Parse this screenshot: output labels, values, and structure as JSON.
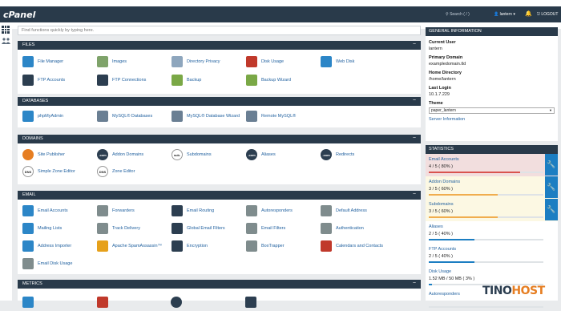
{
  "topbar": {
    "logo": "cPanel",
    "search_placeholder": "Search ( / )",
    "user": "lantern",
    "logout": "LOGOUT"
  },
  "search": {
    "placeholder": "Find functions quickly by typing here."
  },
  "files": {
    "title": "FILES",
    "toggle": "−",
    "items": [
      {
        "label": "File Manager",
        "icon": "file-manager-icon",
        "color": "#2c86c7"
      },
      {
        "label": "Images",
        "icon": "images-icon",
        "color": "#7fa36a"
      },
      {
        "label": "Directory Privacy",
        "icon": "directory-privacy-icon",
        "color": "#8ea6bd"
      },
      {
        "label": "Disk Usage",
        "icon": "disk-usage-icon",
        "color": "#c0392b"
      },
      {
        "label": "Web Disk",
        "icon": "web-disk-icon",
        "color": "#2c86c7"
      },
      {
        "label": "FTP Accounts",
        "icon": "ftp-accounts-icon",
        "color": "#2c3e50"
      },
      {
        "label": "FTP Connections",
        "icon": "ftp-connections-icon",
        "color": "#2c3e50"
      },
      {
        "label": "Backup",
        "icon": "backup-icon",
        "color": "#7aa846"
      },
      {
        "label": "Backup Wizard",
        "icon": "backup-wizard-icon",
        "color": "#7aa846"
      }
    ]
  },
  "databases": {
    "title": "DATABASES",
    "toggle": "−",
    "items": [
      {
        "label": "phpMyAdmin",
        "icon": "phpmyadmin-icon",
        "color": "#2c86c7"
      },
      {
        "label": "MySQL® Databases",
        "icon": "mysql-databases-icon",
        "color": "#6a7f93"
      },
      {
        "label": "MySQL® Database Wizard",
        "icon": "mysql-wizard-icon",
        "color": "#6a7f93"
      },
      {
        "label": "Remote MySQL®",
        "icon": "remote-mysql-icon",
        "color": "#6a7f93"
      }
    ]
  },
  "domains": {
    "title": "DOMAINS",
    "toggle": "−",
    "items": [
      {
        "label": "Site Publisher",
        "icon": "site-publisher-icon",
        "color": "#e67e22",
        "badge": ""
      },
      {
        "label": "Addon Domains",
        "icon": "addon-domains-icon",
        "color": "#2c3e50",
        "badge": ".com"
      },
      {
        "label": "Subdomains",
        "icon": "subdomains-icon",
        "color": "#ffffff",
        "badge": "sub."
      },
      {
        "label": "Aliases",
        "icon": "aliases-icon",
        "color": "#2c3e50",
        "badge": ".com"
      },
      {
        "label": "Redirects",
        "icon": "redirects-icon",
        "color": "#2c3e50",
        "badge": ".com"
      },
      {
        "label": "Simple Zone Editor",
        "icon": "simple-zone-editor-icon",
        "color": "#ffffff",
        "badge": "DNS"
      },
      {
        "label": "Zone Editor",
        "icon": "zone-editor-icon",
        "color": "#ffffff",
        "badge": "DNS"
      }
    ]
  },
  "email": {
    "title": "EMAIL",
    "toggle": "−",
    "items": [
      {
        "label": "Email Accounts",
        "icon": "email-accounts-icon",
        "color": "#2c86c7"
      },
      {
        "label": "Forwarders",
        "icon": "forwarders-icon",
        "color": "#7f8c8d"
      },
      {
        "label": "Email Routing",
        "icon": "email-routing-icon",
        "color": "#2c3e50"
      },
      {
        "label": "Autoresponders",
        "icon": "autoresponders-icon",
        "color": "#7f8c8d"
      },
      {
        "label": "Default Address",
        "icon": "default-address-icon",
        "color": "#7f8c8d"
      },
      {
        "label": "Mailing Lists",
        "icon": "mailing-lists-icon",
        "color": "#2c86c7"
      },
      {
        "label": "Track Delivery",
        "icon": "track-delivery-icon",
        "color": "#7f8c8d"
      },
      {
        "label": "Global Email Filters",
        "icon": "global-email-filters-icon",
        "color": "#2c3e50"
      },
      {
        "label": "Email Filters",
        "icon": "email-filters-icon",
        "color": "#7f8c8d"
      },
      {
        "label": "Authentication",
        "icon": "authentication-icon",
        "color": "#7f8c8d"
      },
      {
        "label": "Address Importer",
        "icon": "address-importer-icon",
        "color": "#2c86c7"
      },
      {
        "label": "Apache SpamAssassin™",
        "icon": "spamassassin-icon",
        "color": "#e6a11b"
      },
      {
        "label": "Encryption",
        "icon": "encryption-icon",
        "color": "#2c3e50"
      },
      {
        "label": "BoxTrapper",
        "icon": "boxtrapper-icon",
        "color": "#7f8c8d"
      },
      {
        "label": "Calendars and Contacts",
        "icon": "calendars-contacts-icon",
        "color": "#c0392b"
      },
      {
        "label": "Email Disk Usage",
        "icon": "email-disk-usage-icon",
        "color": "#7f8c8d"
      }
    ]
  },
  "metrics": {
    "title": "METRICS",
    "toggle": "−"
  },
  "general": {
    "title": "GENERAL INFORMATION",
    "current_user_label": "Current User",
    "current_user": "lantern",
    "primary_domain_label": "Primary Domain",
    "primary_domain": "exampledomain.tld",
    "home_directory_label": "Home Directory",
    "home_directory": "/home/lantern",
    "last_login_label": "Last Login",
    "last_login": "10.1.7.229",
    "theme_label": "Theme",
    "theme": "paper_lantern",
    "server_info": "Server Information"
  },
  "stats": {
    "title": "STATISTICS",
    "items": [
      {
        "label": "Email Accounts",
        "value": "4 / 5 ( 80% )",
        "fraction": 0.8,
        "state": "danger"
      },
      {
        "label": "Addon Domains",
        "value": "3 / 5 ( 60% )",
        "fraction": 0.6,
        "state": "warning"
      },
      {
        "label": "Subdomains",
        "value": "3 / 5 ( 60% )",
        "fraction": 0.6,
        "state": "warning"
      },
      {
        "label": "Aliases",
        "value": "2 / 5 ( 40% )",
        "fraction": 0.4,
        "state": "normal"
      },
      {
        "label": "FTP Accounts",
        "value": "2 / 5 ( 40% )",
        "fraction": 0.4,
        "state": "normal"
      },
      {
        "label": "Disk Usage",
        "value": "1.52 MB / 50 MB ( 3% )",
        "fraction": 0.03,
        "state": "normal"
      },
      {
        "label": "Autoresponders",
        "value": "",
        "fraction": 0,
        "state": "normal"
      }
    ]
  },
  "colors": {
    "danger_bg": "#f2dede",
    "danger_bar": "#d9534f",
    "warning_bg": "#fcf8e3",
    "warning_bar": "#f0ad4e",
    "normal_bar": "#1c7ec2"
  },
  "watermark": {
    "part1": "TINO",
    "part2": "HOST"
  }
}
